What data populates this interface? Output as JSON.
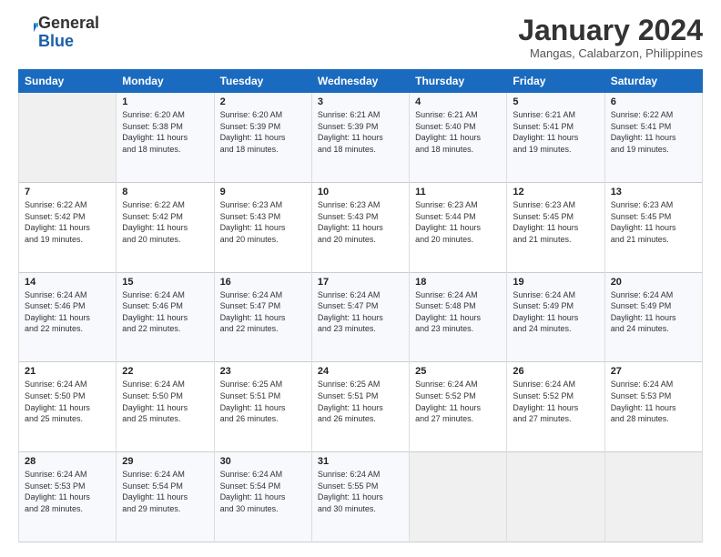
{
  "logo": {
    "general": "General",
    "blue": "Blue"
  },
  "header": {
    "title": "January 2024",
    "subtitle": "Mangas, Calabarzon, Philippines"
  },
  "weekdays": [
    "Sunday",
    "Monday",
    "Tuesday",
    "Wednesday",
    "Thursday",
    "Friday",
    "Saturday"
  ],
  "weeks": [
    [
      {
        "day": "",
        "info": ""
      },
      {
        "day": "1",
        "info": "Sunrise: 6:20 AM\nSunset: 5:38 PM\nDaylight: 11 hours\nand 18 minutes."
      },
      {
        "day": "2",
        "info": "Sunrise: 6:20 AM\nSunset: 5:39 PM\nDaylight: 11 hours\nand 18 minutes."
      },
      {
        "day": "3",
        "info": "Sunrise: 6:21 AM\nSunset: 5:39 PM\nDaylight: 11 hours\nand 18 minutes."
      },
      {
        "day": "4",
        "info": "Sunrise: 6:21 AM\nSunset: 5:40 PM\nDaylight: 11 hours\nand 18 minutes."
      },
      {
        "day": "5",
        "info": "Sunrise: 6:21 AM\nSunset: 5:41 PM\nDaylight: 11 hours\nand 19 minutes."
      },
      {
        "day": "6",
        "info": "Sunrise: 6:22 AM\nSunset: 5:41 PM\nDaylight: 11 hours\nand 19 minutes."
      }
    ],
    [
      {
        "day": "7",
        "info": "Sunrise: 6:22 AM\nSunset: 5:42 PM\nDaylight: 11 hours\nand 19 minutes."
      },
      {
        "day": "8",
        "info": "Sunrise: 6:22 AM\nSunset: 5:42 PM\nDaylight: 11 hours\nand 20 minutes."
      },
      {
        "day": "9",
        "info": "Sunrise: 6:23 AM\nSunset: 5:43 PM\nDaylight: 11 hours\nand 20 minutes."
      },
      {
        "day": "10",
        "info": "Sunrise: 6:23 AM\nSunset: 5:43 PM\nDaylight: 11 hours\nand 20 minutes."
      },
      {
        "day": "11",
        "info": "Sunrise: 6:23 AM\nSunset: 5:44 PM\nDaylight: 11 hours\nand 20 minutes."
      },
      {
        "day": "12",
        "info": "Sunrise: 6:23 AM\nSunset: 5:45 PM\nDaylight: 11 hours\nand 21 minutes."
      },
      {
        "day": "13",
        "info": "Sunrise: 6:23 AM\nSunset: 5:45 PM\nDaylight: 11 hours\nand 21 minutes."
      }
    ],
    [
      {
        "day": "14",
        "info": "Sunrise: 6:24 AM\nSunset: 5:46 PM\nDaylight: 11 hours\nand 22 minutes."
      },
      {
        "day": "15",
        "info": "Sunrise: 6:24 AM\nSunset: 5:46 PM\nDaylight: 11 hours\nand 22 minutes."
      },
      {
        "day": "16",
        "info": "Sunrise: 6:24 AM\nSunset: 5:47 PM\nDaylight: 11 hours\nand 22 minutes."
      },
      {
        "day": "17",
        "info": "Sunrise: 6:24 AM\nSunset: 5:47 PM\nDaylight: 11 hours\nand 23 minutes."
      },
      {
        "day": "18",
        "info": "Sunrise: 6:24 AM\nSunset: 5:48 PM\nDaylight: 11 hours\nand 23 minutes."
      },
      {
        "day": "19",
        "info": "Sunrise: 6:24 AM\nSunset: 5:49 PM\nDaylight: 11 hours\nand 24 minutes."
      },
      {
        "day": "20",
        "info": "Sunrise: 6:24 AM\nSunset: 5:49 PM\nDaylight: 11 hours\nand 24 minutes."
      }
    ],
    [
      {
        "day": "21",
        "info": "Sunrise: 6:24 AM\nSunset: 5:50 PM\nDaylight: 11 hours\nand 25 minutes."
      },
      {
        "day": "22",
        "info": "Sunrise: 6:24 AM\nSunset: 5:50 PM\nDaylight: 11 hours\nand 25 minutes."
      },
      {
        "day": "23",
        "info": "Sunrise: 6:25 AM\nSunset: 5:51 PM\nDaylight: 11 hours\nand 26 minutes."
      },
      {
        "day": "24",
        "info": "Sunrise: 6:25 AM\nSunset: 5:51 PM\nDaylight: 11 hours\nand 26 minutes."
      },
      {
        "day": "25",
        "info": "Sunrise: 6:24 AM\nSunset: 5:52 PM\nDaylight: 11 hours\nand 27 minutes."
      },
      {
        "day": "26",
        "info": "Sunrise: 6:24 AM\nSunset: 5:52 PM\nDaylight: 11 hours\nand 27 minutes."
      },
      {
        "day": "27",
        "info": "Sunrise: 6:24 AM\nSunset: 5:53 PM\nDaylight: 11 hours\nand 28 minutes."
      }
    ],
    [
      {
        "day": "28",
        "info": "Sunrise: 6:24 AM\nSunset: 5:53 PM\nDaylight: 11 hours\nand 28 minutes."
      },
      {
        "day": "29",
        "info": "Sunrise: 6:24 AM\nSunset: 5:54 PM\nDaylight: 11 hours\nand 29 minutes."
      },
      {
        "day": "30",
        "info": "Sunrise: 6:24 AM\nSunset: 5:54 PM\nDaylight: 11 hours\nand 30 minutes."
      },
      {
        "day": "31",
        "info": "Sunrise: 6:24 AM\nSunset: 5:55 PM\nDaylight: 11 hours\nand 30 minutes."
      },
      {
        "day": "",
        "info": ""
      },
      {
        "day": "",
        "info": ""
      },
      {
        "day": "",
        "info": ""
      }
    ]
  ]
}
